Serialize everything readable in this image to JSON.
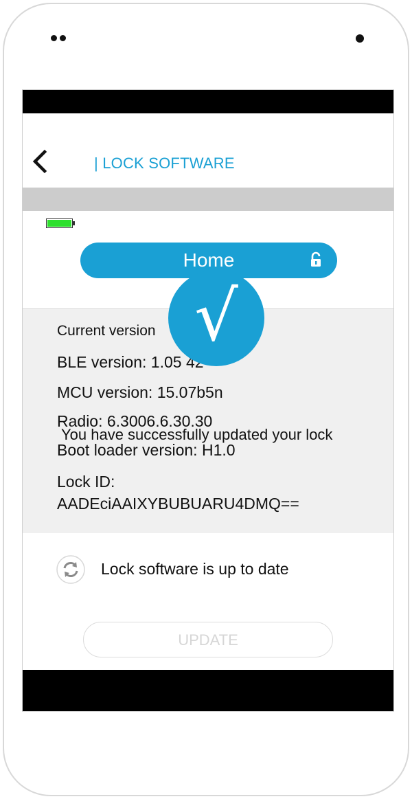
{
  "header": {
    "title": "| LOCK SOFTWARE",
    "back_icon": "chevron-left-icon"
  },
  "device": {
    "battery_icon": "battery-full-icon",
    "battery_color": "#2ee02e",
    "name": "Home",
    "lock_icon": "unlocked-padlock-icon"
  },
  "versions": {
    "current_version_label": "Current version",
    "ble_version": "BLE version:  1.05 42",
    "mcu_version": "MCU version:  15.07b5n",
    "radio": "Radio: 6.3006.6.30.30",
    "boot_loader": "Boot loader version:  H1.0",
    "lock_id_label": "Lock ID:",
    "lock_id_value": "AADEciAAIXYBUBUARU4DMQ=="
  },
  "success": {
    "message": "You have successfully updated your lock",
    "check_glyph": "√"
  },
  "status": {
    "icon": "refresh-icon",
    "text": "Lock software is up to date"
  },
  "update_button": {
    "label": "UPDATE"
  },
  "colors": {
    "accent": "#1aa0d4",
    "info_background": "#f0f0f0",
    "strip": "#cccccc"
  }
}
